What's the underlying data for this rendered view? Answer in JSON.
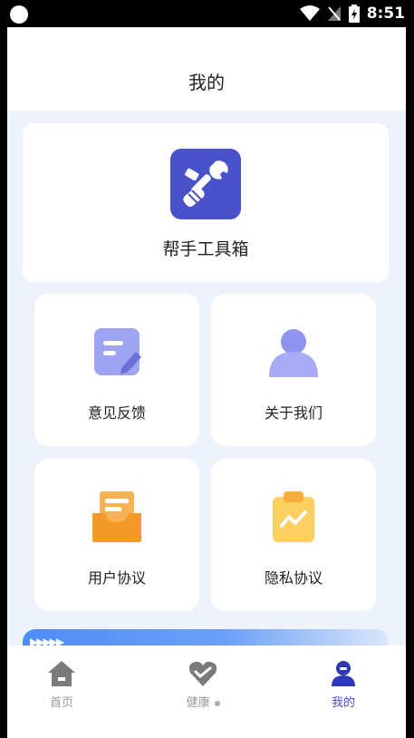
{
  "status_bar": {
    "time": "8:51"
  },
  "header": {
    "title": "我的"
  },
  "toolbox": {
    "label": "帮手工具箱",
    "icon": "wrench-icon",
    "color": "#4a52c9"
  },
  "menu": [
    {
      "label": "意见反馈",
      "icon": "feedback-icon"
    },
    {
      "label": "关于我们",
      "icon": "user-icon"
    },
    {
      "label": "用户协议",
      "icon": "tray-icon"
    },
    {
      "label": "隐私协议",
      "icon": "clipboard-icon"
    }
  ],
  "tabs": [
    {
      "label": "首页",
      "icon": "home-icon",
      "active": false
    },
    {
      "label": "健康",
      "icon": "heart-icon",
      "active": false
    },
    {
      "label": "我的",
      "icon": "profile-icon",
      "active": true
    }
  ],
  "colors": {
    "accent": "#4a52c9",
    "background": "#eef3fb",
    "orange": "#f39a2b",
    "yellow": "#f9c74f",
    "lavender": "#9fa4f2"
  }
}
